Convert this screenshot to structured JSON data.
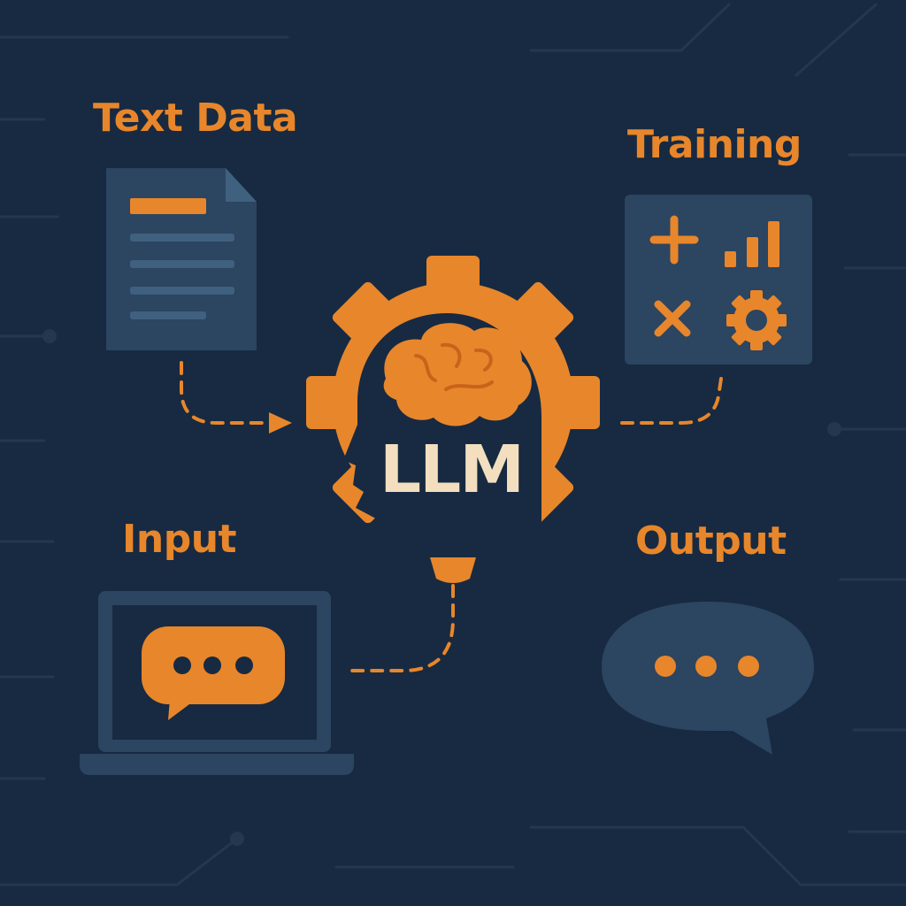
{
  "colors": {
    "background": "#172a41",
    "accent": "#e8862b",
    "panel": "#2c4560",
    "panel_line": "#40607f",
    "circuit": "#23384f",
    "title_text": "#f3dfbf"
  },
  "center": {
    "title": "LLM",
    "icons": [
      "gear-icon",
      "head-silhouette-icon",
      "brain-icon",
      "bulb-base-icon"
    ]
  },
  "text_data": {
    "label": "Text Data",
    "icon": "document-icon"
  },
  "training": {
    "label": "Training",
    "icons": [
      "plus-icon",
      "bar-chart-icon",
      "multiply-icon",
      "gear-icon"
    ]
  },
  "input": {
    "label": "Input",
    "icons": [
      "laptop-icon",
      "chat-bubble-icon"
    ]
  },
  "output": {
    "label": "Output",
    "icons": [
      "chat-bubble-icon"
    ]
  },
  "connectors": [
    {
      "from": "Text Data",
      "to": "LLM",
      "style": "dashed-arrow"
    },
    {
      "from": "Training",
      "to": "LLM",
      "style": "dashed"
    },
    {
      "from": "LLM",
      "to": "Input",
      "style": "dashed"
    }
  ]
}
